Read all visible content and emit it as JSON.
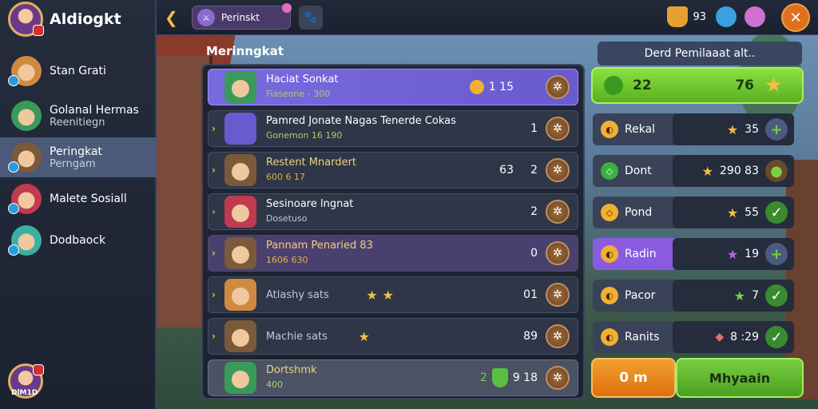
{
  "app": {
    "title": "Aldiogkt"
  },
  "sidebar": {
    "items": [
      {
        "label": "Stan Grati",
        "sub": ""
      },
      {
        "label": "Golanal Hermas",
        "sub": "Reenitiegn"
      },
      {
        "label": "Peringkat",
        "sub": "Perngam"
      },
      {
        "label": "Malete Sosiall",
        "sub": ""
      },
      {
        "label": "Dodbaock",
        "sub": ""
      }
    ],
    "player_badge": "DlM1D"
  },
  "topbar": {
    "tab_label": "Perinskt",
    "resources": [
      {
        "icon": "cup-icon",
        "value": "93"
      },
      {
        "icon": "dice-icon",
        "value": ""
      },
      {
        "icon": "gem-icon",
        "value": ""
      }
    ]
  },
  "leaderboard": {
    "title": "Merinngkat",
    "rows": [
      {
        "name": "Haciat Sonkat",
        "sub": "Fiaseone - 300",
        "mid": "1 15",
        "rank": ""
      },
      {
        "name": "Pamred Jonate Nagas Tenerde Cokas",
        "sub": "Gonemon 16 190",
        "mid": "",
        "rank": "1"
      },
      {
        "name": "Restent Mnardert",
        "sub": "600 6 17",
        "mid": "63",
        "rank": "2"
      },
      {
        "name": "Sesinoare lngnat",
        "sub": "Dosetuso",
        "mid": "",
        "rank": "2"
      },
      {
        "name": "Pannam Penaried 83",
        "sub": "1606 630",
        "mid": "",
        "rank": "0"
      },
      {
        "name": "Atlashy sats",
        "sub": "",
        "mid": "",
        "rank": "01"
      },
      {
        "name": "Machie sats",
        "sub": "",
        "mid": "",
        "rank": "89"
      },
      {
        "name": "Dortshmk",
        "sub": "400",
        "mid": "2",
        "rank": "9 18"
      }
    ]
  },
  "rewards": {
    "title": "Derd Pemilaaat alt..",
    "top": {
      "left": "22",
      "right": "76"
    },
    "rows": [
      {
        "label": "Rekal",
        "value": "35"
      },
      {
        "label": "Dont",
        "value": "290  83"
      },
      {
        "label": "Pond",
        "value": "55"
      },
      {
        "label": "Radin",
        "value": "19"
      },
      {
        "label": "Pacor",
        "value": "7"
      },
      {
        "label": "Ranits",
        "value": "8 :29"
      }
    ],
    "btn_left": "0 m",
    "btn_right": "Mhyaain"
  }
}
